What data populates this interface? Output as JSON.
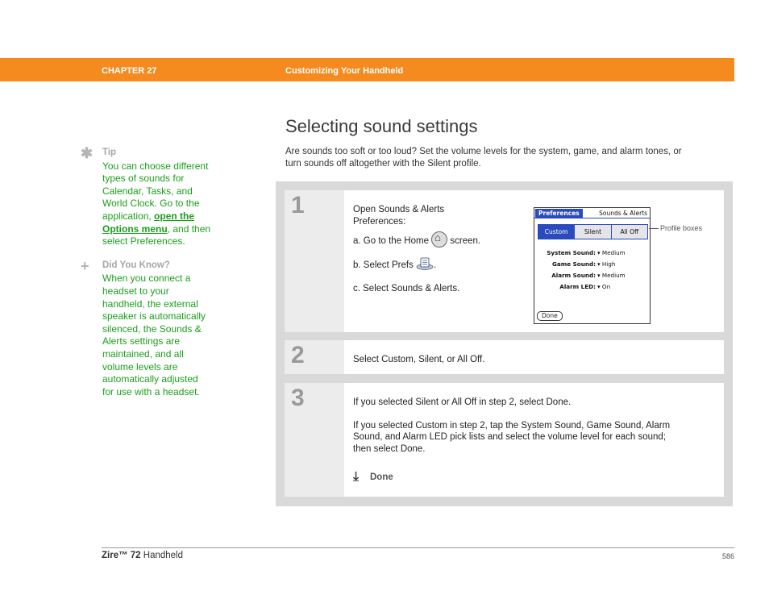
{
  "header": {
    "chapter": "CHAPTER 27",
    "title": "Customizing Your Handheld"
  },
  "sidebar": {
    "tip": {
      "icon": "asterisk-icon",
      "heading": "Tip",
      "lines": [
        "You can choose different",
        "types of sounds for",
        "Calendar, Tasks, and",
        "World Clock. Go to the"
      ],
      "line5_before": "application, ",
      "link1": "open the ",
      "link2": "Options menu",
      "line6_after": ", and then",
      "line7": "select Preferences."
    },
    "did_you_know": {
      "icon": "plus-icon",
      "heading": "Did You Know?",
      "lines": [
        "When you connect a",
        "headset to your",
        "handheld, the external",
        "speaker is automatically",
        "silenced, the Sounds &",
        "Alerts settings are",
        "maintained, and all",
        "volume levels are",
        "automatically adjusted",
        "for use with a headset."
      ]
    }
  },
  "main": {
    "title": "Selecting sound settings",
    "intro_line1": "Are sounds too soft or too loud? Set the volume levels for the system, game, and alarm tones, or",
    "intro_line2": "turn sounds off altogether with the Silent profile."
  },
  "steps": {
    "s1": {
      "num": "1",
      "l1": "Open Sounds & Alerts",
      "l2": "Preferences:",
      "a_before": "a.  Go to the Home",
      "a_after": "screen.",
      "b_before": "b.  Select Prefs",
      "b_after": ".",
      "c": "c.  Select Sounds & Alerts."
    },
    "s2": {
      "num": "2",
      "text": "Select Custom, Silent, or All Off."
    },
    "s3": {
      "num": "3",
      "p1": "If you selected Silent or All Off in step 2, select Done.",
      "p2_l1": "If you selected Custom in step 2, tap the System Sound, Game Sound, Alarm",
      "p2_l2": "Sound, and Alarm LED pick lists and select the volume level for each sound;",
      "p2_l3": "then select Done.",
      "done": "Done",
      "done_icon": "down-arrow-icon"
    }
  },
  "palm": {
    "app": "Preferences",
    "category": "Sounds & Alerts",
    "tabs": [
      "Custom",
      "Silent",
      "All Off"
    ],
    "rows": [
      {
        "label": "System Sound:",
        "value": "Medium"
      },
      {
        "label": "Game Sound:",
        "value": "High"
      },
      {
        "label": "Alarm Sound:",
        "value": "Medium"
      },
      {
        "label": "Alarm LED:",
        "value": "On"
      }
    ],
    "done": "Done",
    "callout": "Profile boxes"
  },
  "footer": {
    "product_bold": "Zire™ 72",
    "product_rest": " Handheld",
    "page": "586"
  },
  "colors": {
    "accent": "#f58a1f",
    "sidebar_text": "#1a9e1a",
    "palm_blue": "#2a4bbd"
  }
}
